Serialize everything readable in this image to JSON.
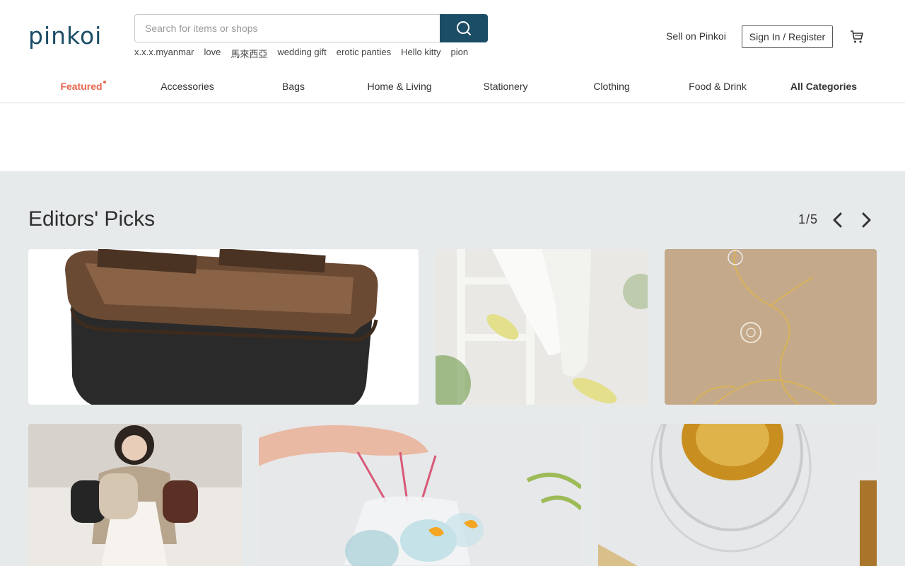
{
  "header": {
    "logo_text": "pinkoi",
    "search": {
      "placeholder": "Search for items or shops",
      "value": "",
      "button_icon": "search-icon"
    },
    "hot_words": [
      "x.x.x.myanmar",
      "love",
      "馬來西亞",
      "wedding gift",
      "erotic panties",
      "Hello kitty",
      "pion"
    ],
    "sell_label": "Sell on Pinkoi",
    "signin_label": "Sign In / Register",
    "cart_icon": "cart-icon",
    "brand_color": "#1c4d66"
  },
  "nav": {
    "items": [
      {
        "label": "Featured",
        "active": true
      },
      {
        "label": "Accessories"
      },
      {
        "label": "Bags"
      },
      {
        "label": "Home & Living"
      },
      {
        "label": "Stationery"
      },
      {
        "label": "Clothing"
      },
      {
        "label": "Food & Drink"
      },
      {
        "label": "All Categories"
      }
    ],
    "active_color": "#e8664e"
  },
  "editors_picks": {
    "title": "Editors' Picks",
    "pager": "1/5",
    "prev_icon": "chevron-left-icon",
    "next_icon": "chevron-right-icon",
    "section_bg": "#e6eaeb",
    "cards": [
      {
        "image": "wooden-tissue-box-photo"
      },
      {
        "image": "embroidered-flats-photo"
      },
      {
        "image": "gold-wire-ornament-photo"
      },
      {
        "image": "woman-with-backpacks-photo"
      },
      {
        "image": "goldfish-bag-charms-photo"
      },
      {
        "image": "tea-in-glass-cup-photo"
      }
    ]
  }
}
